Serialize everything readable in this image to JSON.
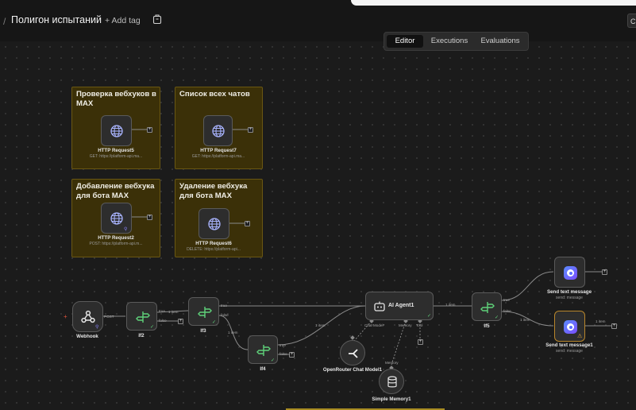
{
  "header": {
    "workflow_title": "Полигон испытаний",
    "add_tag_label": "+ Add tag"
  },
  "tabs": [
    {
      "label": "Editor",
      "active": true
    },
    {
      "label": "Executions",
      "active": false
    },
    {
      "label": "Evaluations",
      "active": false
    }
  ],
  "stickies": [
    {
      "title": "Проверка вебхуков в MAX"
    },
    {
      "title": "Список всех чатов"
    },
    {
      "title": "Добавление вебхука для бота MAX"
    },
    {
      "title": "Удаление вебхука для бота MAX"
    }
  ],
  "nodes": {
    "http5": {
      "name": "HTTP Request5",
      "subtitle": "GET: https://platform-api.ma..."
    },
    "http7": {
      "name": "HTTP Request7",
      "subtitle": "GET: https://platform-api.ma..."
    },
    "http2": {
      "name": "HTTP Request2",
      "subtitle": "POST: https://platform-api.m..."
    },
    "http6": {
      "name": "HTTP Request6",
      "subtitle": "DELETE: https://platform-api..."
    },
    "webhook": {
      "name": "Webhook"
    },
    "if2": {
      "name": "If2"
    },
    "if3": {
      "name": "If3"
    },
    "if4": {
      "name": "If4"
    },
    "agent": {
      "name": "AI Agent1"
    },
    "openrouter": {
      "name": "OpenRouter Chat Model1"
    },
    "memory": {
      "name": "Simple Memory1"
    },
    "if5": {
      "name": "If5"
    },
    "send": {
      "name": "Send text message",
      "subtitle": "send: message"
    },
    "send1": {
      "name": "Send text message1",
      "subtitle": "send: message"
    }
  },
  "labels": {
    "one_item": "1 item",
    "true": "true",
    "false": "false",
    "post": "POST",
    "chat_model": "Chat Model*",
    "memory": "Memory",
    "tool": "Tool",
    "memory_sub": "Memory"
  },
  "colors": {
    "accent_green": "#5fd17a",
    "sticky_bg": "#3b3008",
    "warning": "#b8862b",
    "max_brand": "#3f6cff"
  }
}
